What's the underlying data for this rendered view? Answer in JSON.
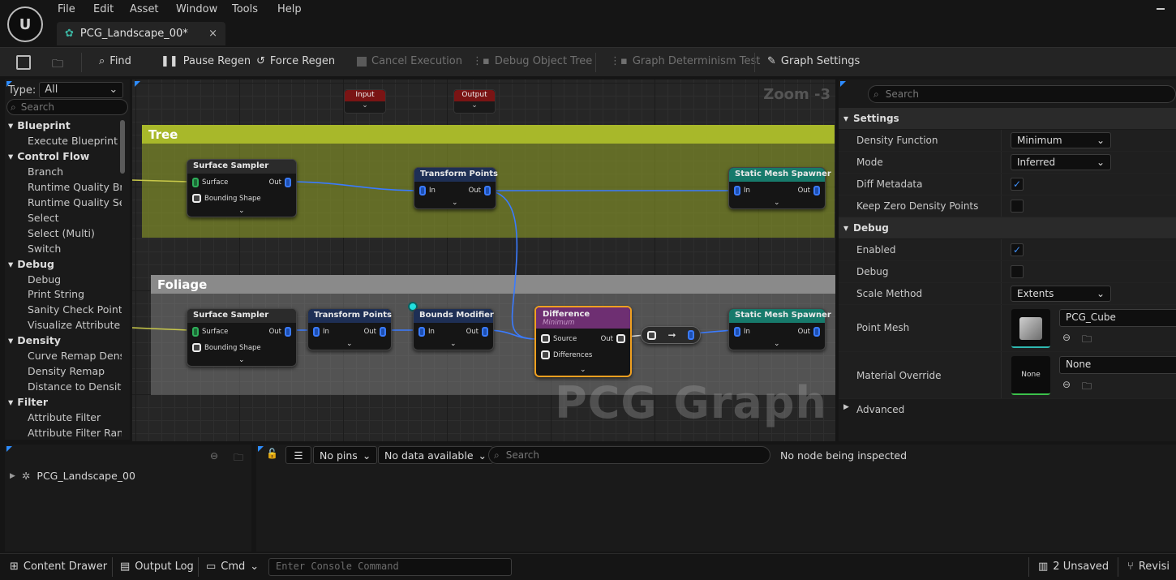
{
  "menu": {
    "items": [
      "File",
      "Edit",
      "Asset",
      "Window",
      "Tools",
      "Help"
    ]
  },
  "tab": {
    "label": "PCG_Landscape_00*",
    "close": "×"
  },
  "toolbar": {
    "find": "Find",
    "pause": "Pause Regen",
    "force": "Force Regen",
    "cancel": "Cancel Execution",
    "debug_tree": "Debug Object Tree",
    "determinism": "Graph Determinism Test",
    "settings": "Graph Settings"
  },
  "palette": {
    "type_label": "Type:",
    "type_value": "All",
    "search_placeholder": "Search",
    "entries": [
      {
        "kind": "cat",
        "label": "Blueprint"
      },
      {
        "kind": "item",
        "label": "Execute Blueprint"
      },
      {
        "kind": "cat",
        "label": "Control Flow"
      },
      {
        "kind": "item",
        "label": "Branch"
      },
      {
        "kind": "item",
        "label": "Runtime Quality Bra"
      },
      {
        "kind": "item",
        "label": "Runtime Quality Sel"
      },
      {
        "kind": "item",
        "label": "Select"
      },
      {
        "kind": "item",
        "label": "Select (Multi)"
      },
      {
        "kind": "item",
        "label": "Switch"
      },
      {
        "kind": "cat",
        "label": "Debug"
      },
      {
        "kind": "item",
        "label": "Debug"
      },
      {
        "kind": "item",
        "label": "Print String"
      },
      {
        "kind": "item",
        "label": "Sanity Check Point"
      },
      {
        "kind": "item",
        "label": "Visualize Attribute"
      },
      {
        "kind": "cat",
        "label": "Density"
      },
      {
        "kind": "item",
        "label": "Curve Remap Dens"
      },
      {
        "kind": "item",
        "label": "Density Remap"
      },
      {
        "kind": "item",
        "label": "Distance to Density"
      },
      {
        "kind": "cat",
        "label": "Filter"
      },
      {
        "kind": "item",
        "label": "Attribute Filter"
      },
      {
        "kind": "item",
        "label": "Attribute Filter Rang"
      }
    ]
  },
  "graph": {
    "zoom": "Zoom -3",
    "watermark": "PCG Graph",
    "input": "Input",
    "output": "Output",
    "comments": {
      "tree": "Tree",
      "foliage": "Foliage"
    },
    "nodes": {
      "surface_sampler": "Surface Sampler",
      "transform_points": "Transform Points",
      "static_mesh_spawner": "Static Mesh Spawner",
      "bounds_modifier": "Bounds Modifier",
      "difference": "Difference",
      "difference_sub": "Minimum"
    },
    "pins": {
      "surface": "Surface",
      "bounding_shape": "Bounding Shape",
      "out": "Out",
      "in": "In",
      "source": "Source",
      "differences": "Differences"
    }
  },
  "details": {
    "search_placeholder": "Search",
    "settings_header": "Settings",
    "density_function_label": "Density Function",
    "density_function_value": "Minimum",
    "mode_label": "Mode",
    "mode_value": "Inferred",
    "diff_metadata_label": "Diff Metadata",
    "diff_metadata_checked": true,
    "keep_zero_label": "Keep Zero Density Points",
    "keep_zero_checked": false,
    "debug_header": "Debug",
    "enabled_label": "Enabled",
    "enabled_checked": true,
    "debug_label": "Debug",
    "debug_checked": false,
    "scale_method_label": "Scale Method",
    "scale_method_value": "Extents",
    "point_mesh_label": "Point Mesh",
    "point_mesh_value": "PCG_Cube",
    "material_override_label": "Material Override",
    "material_override_value": "None",
    "material_thumb": "None",
    "advanced_label": "Advanced"
  },
  "bottom": {
    "tree_item": "PCG_Landscape_00",
    "pins_dd": "No pins",
    "data_dd": "No data available",
    "search_placeholder": "Search",
    "inspect_status": "No node being inspected"
  },
  "statusbar": {
    "content_drawer": "Content Drawer",
    "output_log": "Output Log",
    "cmd": "Cmd",
    "console_placeholder": "Enter Console Command",
    "unsaved": "2 Unsaved",
    "revision": "Revisi"
  },
  "colors": {
    "accent_blue": "#3a7bff",
    "tree_comment": "#a8b82a",
    "foliage_comment": "#8a8a8a",
    "diff_border": "#f0a020",
    "check": "#3e8ef7"
  }
}
